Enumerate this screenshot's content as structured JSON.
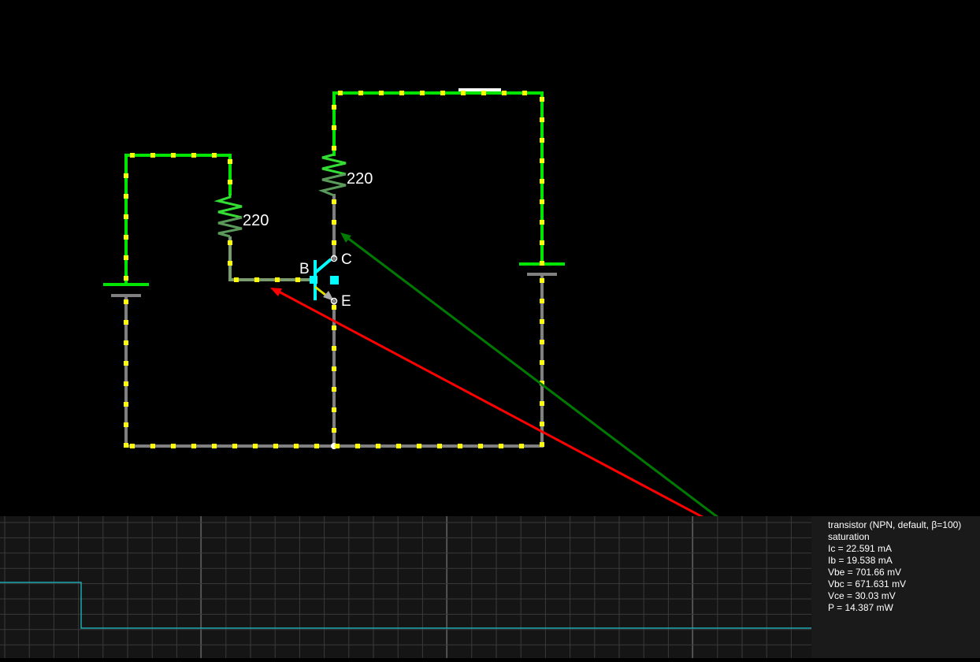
{
  "components": {
    "resistor_left": {
      "label": "220"
    },
    "resistor_top": {
      "label": "220"
    },
    "transistor": {
      "base_label": "B",
      "collector_label": "C",
      "emitter_label": "E"
    }
  },
  "colors": {
    "wire_high": "#00e600",
    "wire_low": "#808080",
    "current_dot": "#ffff00",
    "transistor": "#00ffff",
    "probe_vbe": "#ff0000",
    "probe_vce": "#008000",
    "scope_trace": "#1ea8b0"
  },
  "scope": {
    "info_lines": [
      "transistor (NPN, default, β=100)",
      "saturation",
      "Ic = 22.591 mA",
      "Ib = 19.538 mA",
      "Vbe = 701.66 mV",
      "Vbc = 671.631 mV",
      "Vce = 30.03 mV",
      "P = 14.387 mW"
    ]
  }
}
